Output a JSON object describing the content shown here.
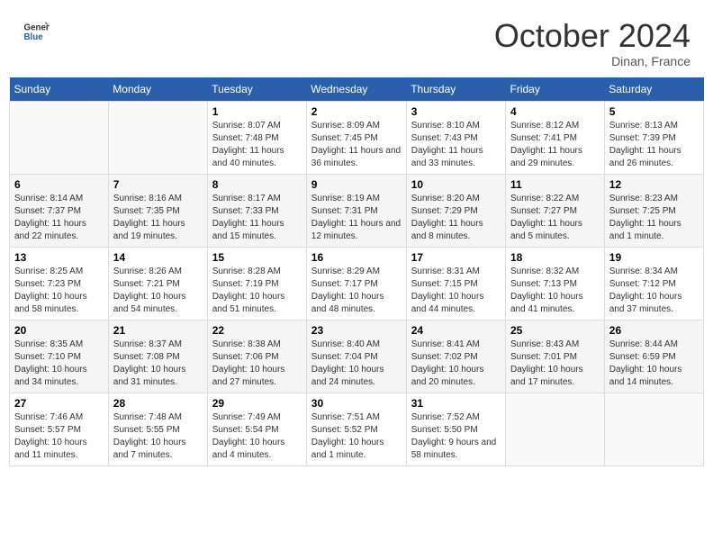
{
  "header": {
    "logo_general": "General",
    "logo_blue": "Blue",
    "month_title": "October 2024",
    "location": "Dinan, France"
  },
  "days_of_week": [
    "Sunday",
    "Monday",
    "Tuesday",
    "Wednesday",
    "Thursday",
    "Friday",
    "Saturday"
  ],
  "weeks": [
    [
      {
        "day": "",
        "info": ""
      },
      {
        "day": "",
        "info": ""
      },
      {
        "day": "1",
        "info": "Sunrise: 8:07 AM\nSunset: 7:48 PM\nDaylight: 11 hours and 40 minutes."
      },
      {
        "day": "2",
        "info": "Sunrise: 8:09 AM\nSunset: 7:45 PM\nDaylight: 11 hours and 36 minutes."
      },
      {
        "day": "3",
        "info": "Sunrise: 8:10 AM\nSunset: 7:43 PM\nDaylight: 11 hours and 33 minutes."
      },
      {
        "day": "4",
        "info": "Sunrise: 8:12 AM\nSunset: 7:41 PM\nDaylight: 11 hours and 29 minutes."
      },
      {
        "day": "5",
        "info": "Sunrise: 8:13 AM\nSunset: 7:39 PM\nDaylight: 11 hours and 26 minutes."
      }
    ],
    [
      {
        "day": "6",
        "info": "Sunrise: 8:14 AM\nSunset: 7:37 PM\nDaylight: 11 hours and 22 minutes."
      },
      {
        "day": "7",
        "info": "Sunrise: 8:16 AM\nSunset: 7:35 PM\nDaylight: 11 hours and 19 minutes."
      },
      {
        "day": "8",
        "info": "Sunrise: 8:17 AM\nSunset: 7:33 PM\nDaylight: 11 hours and 15 minutes."
      },
      {
        "day": "9",
        "info": "Sunrise: 8:19 AM\nSunset: 7:31 PM\nDaylight: 11 hours and 12 minutes."
      },
      {
        "day": "10",
        "info": "Sunrise: 8:20 AM\nSunset: 7:29 PM\nDaylight: 11 hours and 8 minutes."
      },
      {
        "day": "11",
        "info": "Sunrise: 8:22 AM\nSunset: 7:27 PM\nDaylight: 11 hours and 5 minutes."
      },
      {
        "day": "12",
        "info": "Sunrise: 8:23 AM\nSunset: 7:25 PM\nDaylight: 11 hours and 1 minute."
      }
    ],
    [
      {
        "day": "13",
        "info": "Sunrise: 8:25 AM\nSunset: 7:23 PM\nDaylight: 10 hours and 58 minutes."
      },
      {
        "day": "14",
        "info": "Sunrise: 8:26 AM\nSunset: 7:21 PM\nDaylight: 10 hours and 54 minutes."
      },
      {
        "day": "15",
        "info": "Sunrise: 8:28 AM\nSunset: 7:19 PM\nDaylight: 10 hours and 51 minutes."
      },
      {
        "day": "16",
        "info": "Sunrise: 8:29 AM\nSunset: 7:17 PM\nDaylight: 10 hours and 48 minutes."
      },
      {
        "day": "17",
        "info": "Sunrise: 8:31 AM\nSunset: 7:15 PM\nDaylight: 10 hours and 44 minutes."
      },
      {
        "day": "18",
        "info": "Sunrise: 8:32 AM\nSunset: 7:13 PM\nDaylight: 10 hours and 41 minutes."
      },
      {
        "day": "19",
        "info": "Sunrise: 8:34 AM\nSunset: 7:12 PM\nDaylight: 10 hours and 37 minutes."
      }
    ],
    [
      {
        "day": "20",
        "info": "Sunrise: 8:35 AM\nSunset: 7:10 PM\nDaylight: 10 hours and 34 minutes."
      },
      {
        "day": "21",
        "info": "Sunrise: 8:37 AM\nSunset: 7:08 PM\nDaylight: 10 hours and 31 minutes."
      },
      {
        "day": "22",
        "info": "Sunrise: 8:38 AM\nSunset: 7:06 PM\nDaylight: 10 hours and 27 minutes."
      },
      {
        "day": "23",
        "info": "Sunrise: 8:40 AM\nSunset: 7:04 PM\nDaylight: 10 hours and 24 minutes."
      },
      {
        "day": "24",
        "info": "Sunrise: 8:41 AM\nSunset: 7:02 PM\nDaylight: 10 hours and 20 minutes."
      },
      {
        "day": "25",
        "info": "Sunrise: 8:43 AM\nSunset: 7:01 PM\nDaylight: 10 hours and 17 minutes."
      },
      {
        "day": "26",
        "info": "Sunrise: 8:44 AM\nSunset: 6:59 PM\nDaylight: 10 hours and 14 minutes."
      }
    ],
    [
      {
        "day": "27",
        "info": "Sunrise: 7:46 AM\nSunset: 5:57 PM\nDaylight: 10 hours and 11 minutes."
      },
      {
        "day": "28",
        "info": "Sunrise: 7:48 AM\nSunset: 5:55 PM\nDaylight: 10 hours and 7 minutes."
      },
      {
        "day": "29",
        "info": "Sunrise: 7:49 AM\nSunset: 5:54 PM\nDaylight: 10 hours and 4 minutes."
      },
      {
        "day": "30",
        "info": "Sunrise: 7:51 AM\nSunset: 5:52 PM\nDaylight: 10 hours and 1 minute."
      },
      {
        "day": "31",
        "info": "Sunrise: 7:52 AM\nSunset: 5:50 PM\nDaylight: 9 hours and 58 minutes."
      },
      {
        "day": "",
        "info": ""
      },
      {
        "day": "",
        "info": ""
      }
    ]
  ]
}
